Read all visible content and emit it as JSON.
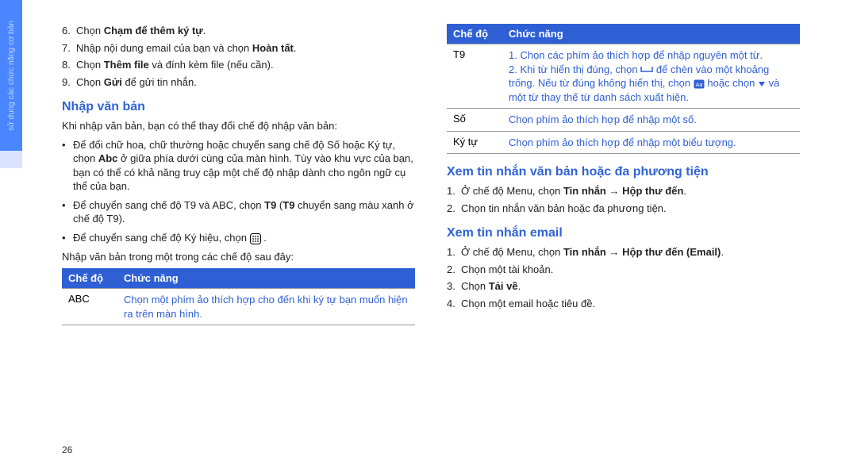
{
  "sideTab": "sử dụng các chức năng cơ bản",
  "pageNumber": "26",
  "col1": {
    "steps": [
      {
        "num": "6.",
        "textA": "Chọn ",
        "bold": "Chạm để thêm ký tự",
        "textB": "."
      },
      {
        "num": "7.",
        "textA": "Nhập nội dung email của bạn và chọn ",
        "bold": "Hoàn tất",
        "textB": "."
      },
      {
        "num": "8.",
        "textA": "Chọn ",
        "bold": "Thêm file",
        "textB": " và đính kèm file (nếu cần)."
      },
      {
        "num": "9.",
        "textA": "Chọn ",
        "bold": "Gửi",
        "textB": " để gửi tin nhắn."
      }
    ],
    "heading1": "Nhập văn bản",
    "para1": "Khi nhập văn bản, bạn có thể thay đổi chế độ nhập văn bản:",
    "bullets": [
      {
        "pre": "Để đổi chữ hoa, chữ thường hoặc chuyển sang chế độ Số hoặc Ký tự, chọn ",
        "bold": "Abc",
        "post": " ở giữa phía dưới cùng của màn hình. Tùy vào khu vực của bạn, bạn có thể có khả năng truy cập một chế độ nhập dành cho ngôn ngữ cụ thể của bạn."
      },
      {
        "pre": "Để chuyển sang chế độ T9 và ABC, chọn ",
        "bold": "T9",
        "mid": " (",
        "bold2": "T9",
        "post": " chuyển sang màu xanh ở chế độ T9)."
      },
      {
        "pre": "Để chuyển sang chế độ Ký hiệu, chọn ",
        "icon": "keypad-icon",
        "post": "."
      }
    ],
    "para2": "Nhập văn bản trong một trong các chế độ sau đây:",
    "table1": {
      "h1": "Chế độ",
      "h2": "Chức năng",
      "rows": [
        {
          "label": "ABC",
          "desc": "Chọn một phím ảo thích hợp cho đến khi ký tự bạn muốn hiện ra trên màn hình."
        }
      ]
    }
  },
  "col2": {
    "table2": {
      "h1": "Chế độ",
      "h2": "Chức năng",
      "rows": [
        {
          "label": "T9",
          "parts": {
            "p1": "1. Chọn các phím ảo thích hợp để nhập nguyên một từ.",
            "p2a": "2. Khi từ hiển thị đúng, chọn ",
            "p2b": " để chèn vào một khoảng trống. Nếu từ đúng không hiển thị, chọn ",
            "p2c": " hoặc chọn ",
            "p2d": " và một từ thay thế từ danh sách xuất hiện."
          }
        },
        {
          "label": "Số",
          "desc": "Chọn phím ảo thích hợp để nhập một số."
        },
        {
          "label": "Ký tự",
          "desc": "Chọn phím ảo thích hợp để nhập một biểu tượng."
        }
      ]
    },
    "heading2": "Xem tin nhắn văn bản hoặc đa phương tiện",
    "steps2": [
      {
        "num": "1.",
        "textA": "Ở chế độ Menu, chọn ",
        "bold": "Tin nhắn",
        "arrow": " → ",
        "bold2": "Hộp thư đến",
        "textB": "."
      },
      {
        "num": "2.",
        "textA": "Chọn tin nhắn văn bản hoặc đa phương tiện."
      }
    ],
    "heading3": "Xem tin nhắn email",
    "steps3": [
      {
        "num": "1.",
        "textA": "Ở chế độ Menu, chọn ",
        "bold": "Tin nhắn",
        "arrow": " → ",
        "bold2": "Hộp thư đến (Email)",
        "textB": "."
      },
      {
        "num": "2.",
        "textA": "Chọn một tài khoản."
      },
      {
        "num": "3.",
        "textA": "Chọn ",
        "bold": "Tải về",
        "textB": "."
      },
      {
        "num": "4.",
        "textA": "Chọn một email hoặc tiêu đề."
      }
    ]
  }
}
